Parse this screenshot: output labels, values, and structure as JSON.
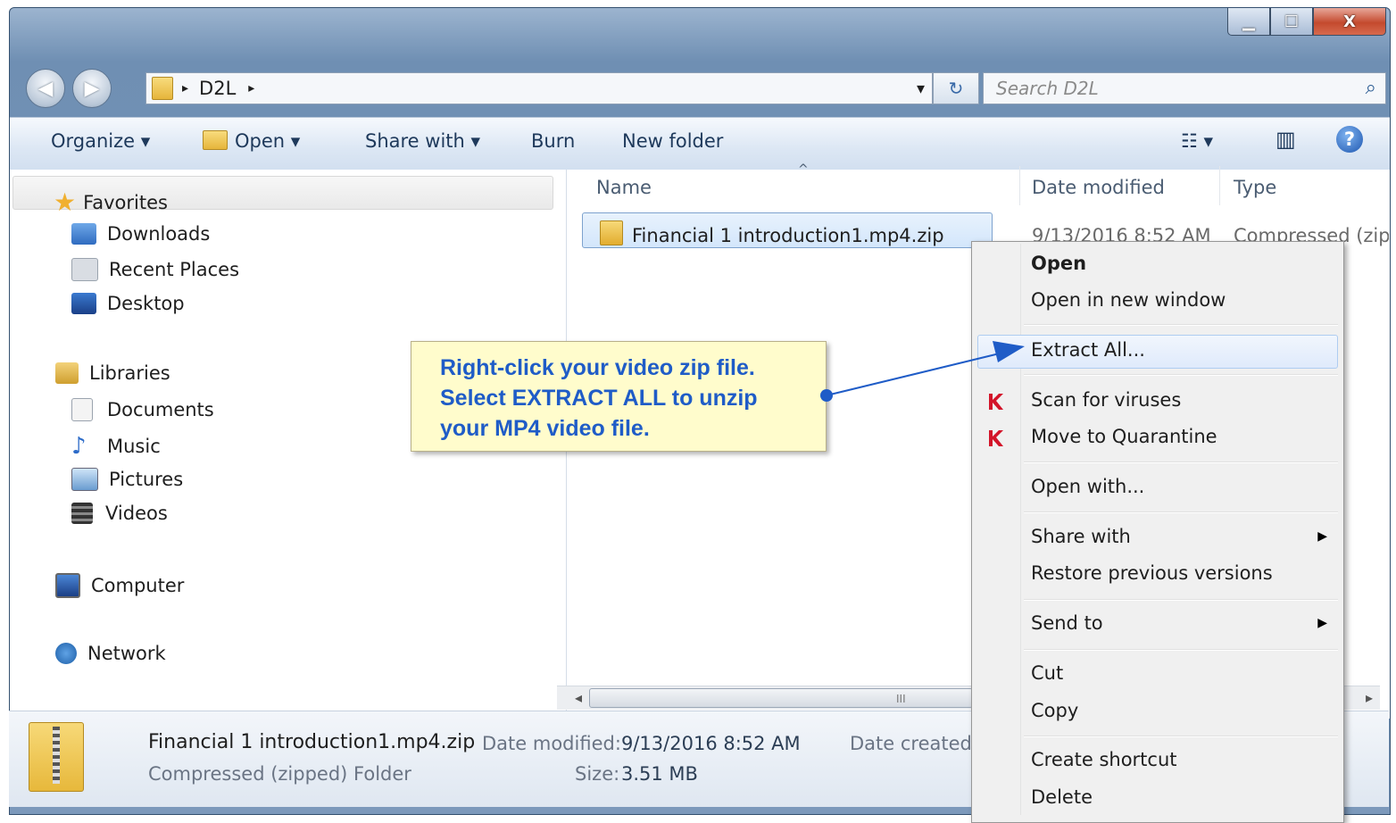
{
  "window": {
    "minimize_glyph": "▁",
    "maximize_glyph": "☐",
    "close_glyph": "X"
  },
  "address": {
    "breadcrumb_sep": "▸",
    "folder": "D2L",
    "trail_arrow": "▸",
    "dropdown": "▾",
    "refresh": "↻"
  },
  "search": {
    "placeholder": "Search D2L",
    "icon": "⌕"
  },
  "toolbar": {
    "organize": "Organize ▾",
    "open": "Open ▾",
    "share_with": "Share with ▾",
    "burn": "Burn",
    "new_folder": "New folder",
    "views_icon": "☷ ▾",
    "preview_icon": "▥",
    "help_icon": "?"
  },
  "nav": {
    "favorites": "Favorites",
    "downloads": "Downloads",
    "recent_places": "Recent Places",
    "desktop": "Desktop",
    "libraries": "Libraries",
    "documents": "Documents",
    "music": "Music",
    "pictures": "Pictures",
    "videos": "Videos",
    "computer": "Computer",
    "network": "Network"
  },
  "columns": {
    "name": "Name",
    "date_modified": "Date modified",
    "type": "Type",
    "sort_glyph": "^"
  },
  "file": {
    "name": "Financial  1 introduction1.mp4.zip",
    "date": "9/13/2016 8:52 AM",
    "type": "Compressed (zipp"
  },
  "scrollbar": {
    "left": "◂",
    "grip": "III",
    "right": "▸"
  },
  "details": {
    "name": "Financial  1 introduction1.mp4.zip",
    "kind": "Compressed (zipped) Folder",
    "date_modified_label": "Date modified:",
    "date_modified_value": "9/13/2016 8:52 AM",
    "size_label": "Size:",
    "size_value": "3.51 MB",
    "date_created_label": "Date created:"
  },
  "context_menu": {
    "open": "Open",
    "open_new_window": "Open in new window",
    "extract_all": "Extract All...",
    "scan": "Scan for viruses",
    "quarantine": "Move to Quarantine",
    "open_with": "Open with...",
    "share_with": "Share with",
    "restore": "Restore previous versions",
    "send_to": "Send to",
    "cut": "Cut",
    "copy": "Copy",
    "create_shortcut": "Create shortcut",
    "delete": "Delete",
    "submenu_arrow": "▶"
  },
  "callout": {
    "line1": "Right-click your video zip file.",
    "line2": "Select EXTRACT ALL to unzip",
    "line3": "your MP4 video file."
  },
  "colors": {
    "callout_text": "#1f5cc7",
    "callout_bg": "#fffccc",
    "arrow": "#1f5cc7"
  }
}
